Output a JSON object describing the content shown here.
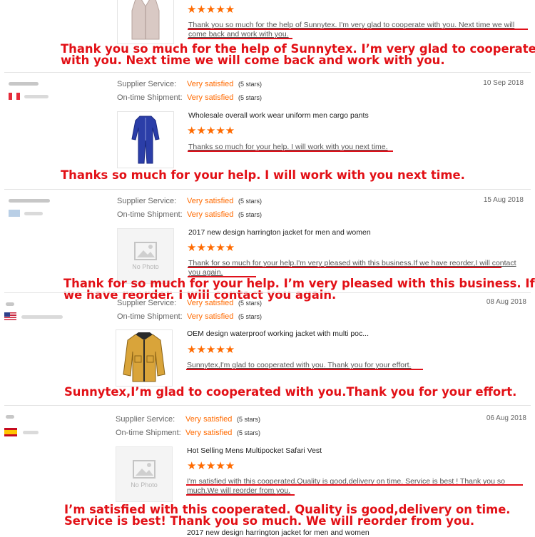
{
  "labels": {
    "supplier_service": "Supplier Service:",
    "ontime_shipment": "On-time Shipment:",
    "very_satisfied": "Very satisfied",
    "five_stars": "(5 stars)",
    "no_photo": "No Photo"
  },
  "stars": "★★★★★",
  "colors": {
    "accent": "#ff6a00",
    "overlay_red": "#e21016",
    "underline": "#e0101a"
  },
  "reviews": [
    {
      "comment": "Thank you so much for the help of Sunnytex. I'm very glad to cooperate with you. Next time we will come back and work with you.",
      "overlay": [
        "Thank you so much for the help of Sunnytex. I’m very glad to cooperate",
        "with you. Next time we will come back and work with you."
      ]
    },
    {
      "date": "10 Sep 2018",
      "product": "Wholesale overall work wear uniform men cargo pants",
      "comment": "Thanks so much for your help. I will work with you next time.",
      "overlay": [
        "Thanks so much for your help. I will work with you next time."
      ]
    },
    {
      "date": "15 Aug 2018",
      "product": "2017 new design harrington jacket for men and women",
      "comment": "Thank for so much for your help.I'm very pleased with this business.If we have reorder,I will contact you again.",
      "overlay": [
        "Thank for so much for your help. I’m very pleased with this business. If",
        "we have reorder. I will contact you again."
      ]
    },
    {
      "date": "08 Aug 2018",
      "product": "OEM design waterproof working jacket with multi poc...",
      "comment": "Sunnytex,I'm glad to cooperated with you. Thank you for your effort.",
      "overlay": [
        "Sunnytex,I’m glad to cooperated with you.Thank you for your effort."
      ]
    },
    {
      "date": "06 Aug 2018",
      "product": "Hot Selling Mens Multipocket Safari Vest",
      "comment": "I'm satisfied with this cooperated.Quality is good,delivery on time. Service is best ! Thank you so much.We will reorder from you.",
      "overlay": [
        "I’m satisfied with this cooperated. Quality is good,delivery on time.",
        "Service is best! Thank you so much. We will reorder from you."
      ]
    },
    {
      "product": "2017 new design harrington jacket for men and women"
    }
  ]
}
